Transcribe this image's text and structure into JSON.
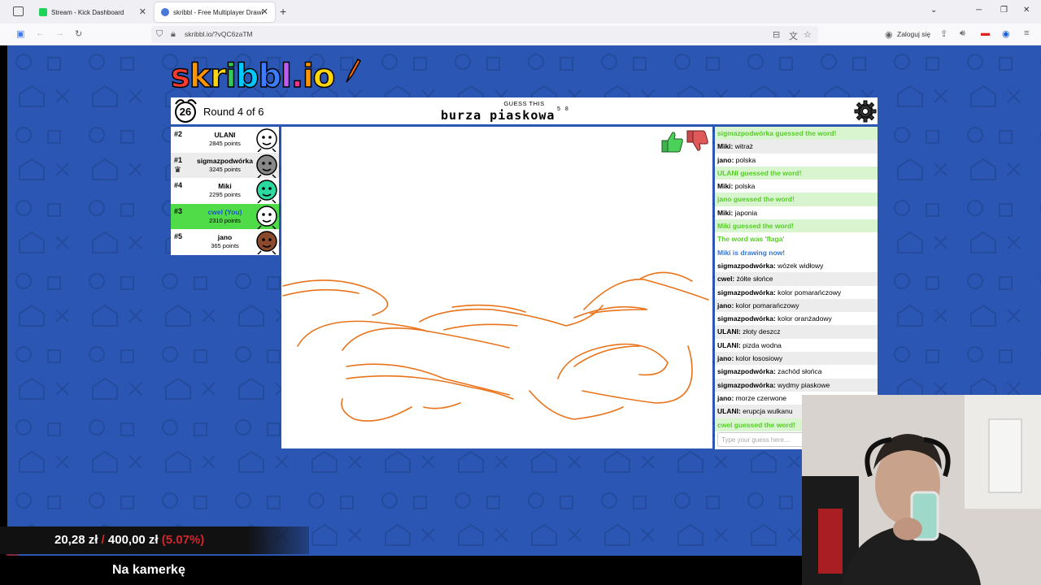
{
  "browser": {
    "tabs": [
      {
        "title": "Stream - Kick Dashboard",
        "active": false
      },
      {
        "title": "skribbl - Free Multiplayer Drawing",
        "active": true
      }
    ],
    "url": "skribbl.io/?vQC6zaTM",
    "login_label": "Zaloguj się"
  },
  "game": {
    "logo_letters": [
      {
        "ch": "s",
        "color": "#ff3b30"
      },
      {
        "ch": "k",
        "color": "#ff9500"
      },
      {
        "ch": "r",
        "color": "#ffd60a"
      },
      {
        "ch": "i",
        "color": "#34c759"
      },
      {
        "ch": "b",
        "color": "#00c7ff"
      },
      {
        "ch": "b",
        "color": "#3d7bff"
      },
      {
        "ch": "l",
        "color": "#bf5af2"
      },
      {
        "ch": ".",
        "color": "#ff2d92"
      },
      {
        "ch": "i",
        "color": "#ff9500"
      },
      {
        "ch": "o",
        "color": "#ffd60a"
      }
    ],
    "timer": "26",
    "round_label": "Round 4 of 6",
    "guess_label": "GUESS THIS",
    "word_hint": "burza piaskowa",
    "word_lengths": "5 8",
    "players": [
      {
        "rank": "#2",
        "name": "ULANI",
        "points": "2845 points",
        "crown": false,
        "avatar_color": "#ffffff",
        "highlight": "none"
      },
      {
        "rank": "#1",
        "name": "sigmazpodwórka",
        "points": "3245 points",
        "crown": true,
        "avatar_color": "#888888",
        "highlight": "alt"
      },
      {
        "rank": "#4",
        "name": "Miki",
        "points": "2295 points",
        "crown": false,
        "avatar_color": "#2bd9a0",
        "highlight": "none"
      },
      {
        "rank": "#3",
        "name": "cwel (You)",
        "points": "2310 points",
        "crown": false,
        "avatar_color": "#ffffff",
        "highlight": "me"
      },
      {
        "rank": "#5",
        "name": "jano",
        "points": "365 points",
        "crown": false,
        "avatar_color": "#8a4a2b",
        "highlight": "none"
      }
    ],
    "chat": [
      {
        "type": "guessed",
        "text": "sigmazpodwórka guessed the word!"
      },
      {
        "type": "normal",
        "user": "Miki:",
        "text": " witraż"
      },
      {
        "type": "normal",
        "user": "jano:",
        "text": " polska"
      },
      {
        "type": "guessed",
        "text": "ULANI guessed the word!"
      },
      {
        "type": "normal",
        "user": "Miki:",
        "text": " polska"
      },
      {
        "type": "guessed",
        "text": "jano guessed the word!"
      },
      {
        "type": "normal",
        "user": "Miki:",
        "text": " japonia"
      },
      {
        "type": "guessed",
        "text": "Miki guessed the word!"
      },
      {
        "type": "sys",
        "text": "The word was 'flaga'"
      },
      {
        "type": "info",
        "text": "Miki is drawing now!"
      },
      {
        "type": "normal",
        "user": "sigmazpodwórka:",
        "text": " wózek widłowy"
      },
      {
        "type": "normal",
        "user": "cwel:",
        "text": " żółte słońce"
      },
      {
        "type": "normal",
        "user": "sigmazpodwórka:",
        "text": " kolor pomarańczowy"
      },
      {
        "type": "normal",
        "user": "jano:",
        "text": " kolor pomarańczowy"
      },
      {
        "type": "normal",
        "user": "sigmazpodwórka:",
        "text": " kolor oranżadowy"
      },
      {
        "type": "normal",
        "user": "ULANI:",
        "text": " złoty deszcz"
      },
      {
        "type": "normal",
        "user": "ULANI:",
        "text": " pizda wodna"
      },
      {
        "type": "normal",
        "user": "jano:",
        "text": " kolor łososiowy"
      },
      {
        "type": "normal",
        "user": "sigmazpodwórka:",
        "text": " zachód słońca"
      },
      {
        "type": "normal",
        "user": "sigmazpodwórka:",
        "text": " wydmy piaskowe"
      },
      {
        "type": "normal",
        "user": "jano:",
        "text": " morze czerwone"
      },
      {
        "type": "normal",
        "user": "ULANI:",
        "text": " erupcja wulkanu"
      },
      {
        "type": "guessed",
        "text": "cwel guessed the word!"
      }
    ],
    "chat_placeholder": "Type your guess here...",
    "stroke_color": "#e8731a"
  },
  "overlay": {
    "amount_current": "20,28 zł",
    "amount_sep": " / ",
    "amount_goal": "400,00 zł",
    "amount_pct": "(5.07%)",
    "caption": "Na kamerkę"
  }
}
